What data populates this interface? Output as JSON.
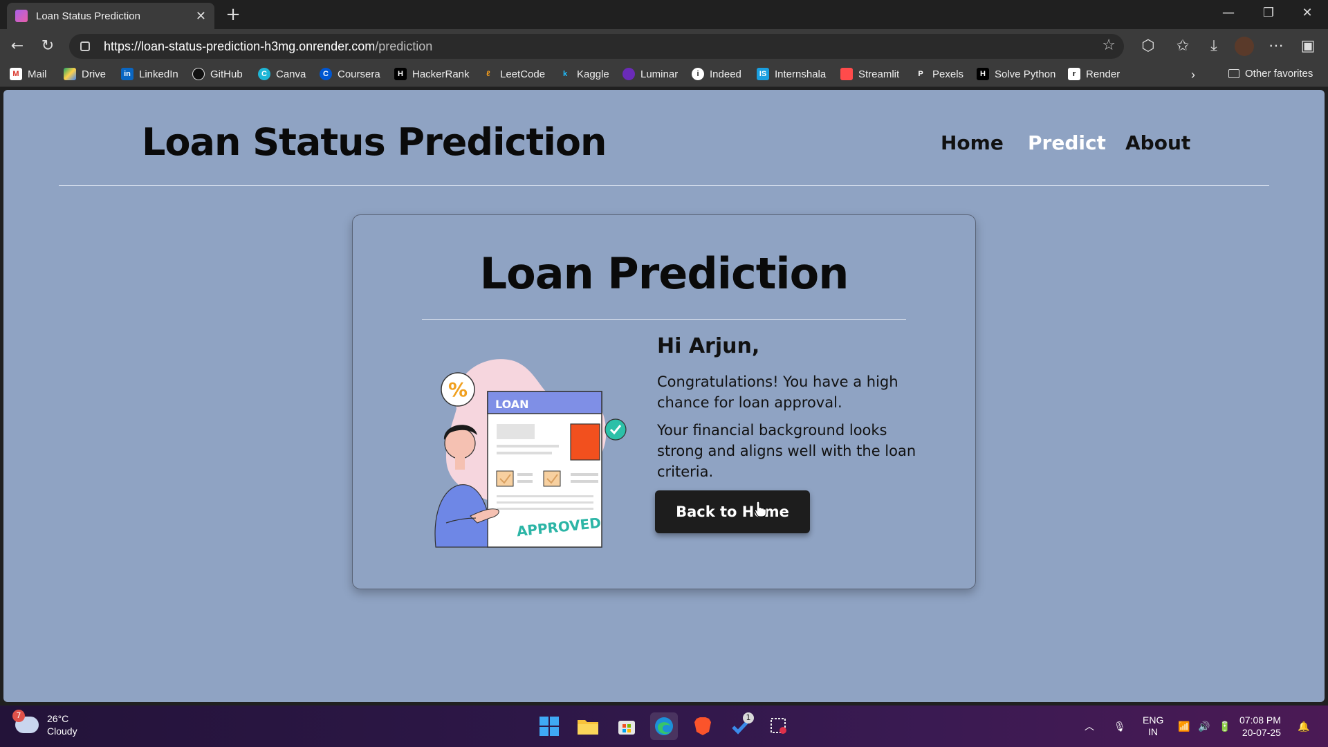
{
  "browser": {
    "tab_title": "Loan Status Prediction",
    "url_host": "https://loan-status-prediction-h3mg.onrender.com",
    "url_path": "/prediction",
    "bookmarks": [
      "Mail",
      "Drive",
      "LinkedIn",
      "GitHub",
      "Canva",
      "Coursera",
      "HackerRank",
      "LeetCode",
      "Kaggle",
      "Luminar",
      "Indeed",
      "Internshala",
      "Streamlit",
      "Pexels",
      "Solve Python",
      "Render"
    ],
    "other_favorites": "Other favorites"
  },
  "site": {
    "title": "Loan Status Prediction",
    "nav": [
      "Home",
      "Predict",
      "About"
    ],
    "active_nav": "Predict"
  },
  "card": {
    "title": "Loan Prediction",
    "greeting": "Hi Arjun,",
    "message1": "Congratulations! You have a high chance for loan approval.",
    "message2": "Your financial background looks strong and aligns well with the loan criteria.",
    "button": "Back to Home",
    "illustration": {
      "doc_header": "LOAN",
      "stamp": "APPROVED",
      "badge": "%"
    }
  },
  "taskbar": {
    "weather_temp": "26°C",
    "weather_desc": "Cloudy",
    "weather_badge": "7",
    "lang1": "ENG",
    "lang2": "IN",
    "time": "07:08 PM",
    "date": "20-07-25",
    "app_badge": "1"
  },
  "colors": {
    "page_bg": "#8fa3c3",
    "button_bg": "#1d1d1d",
    "active_nav": "#ffffff"
  }
}
